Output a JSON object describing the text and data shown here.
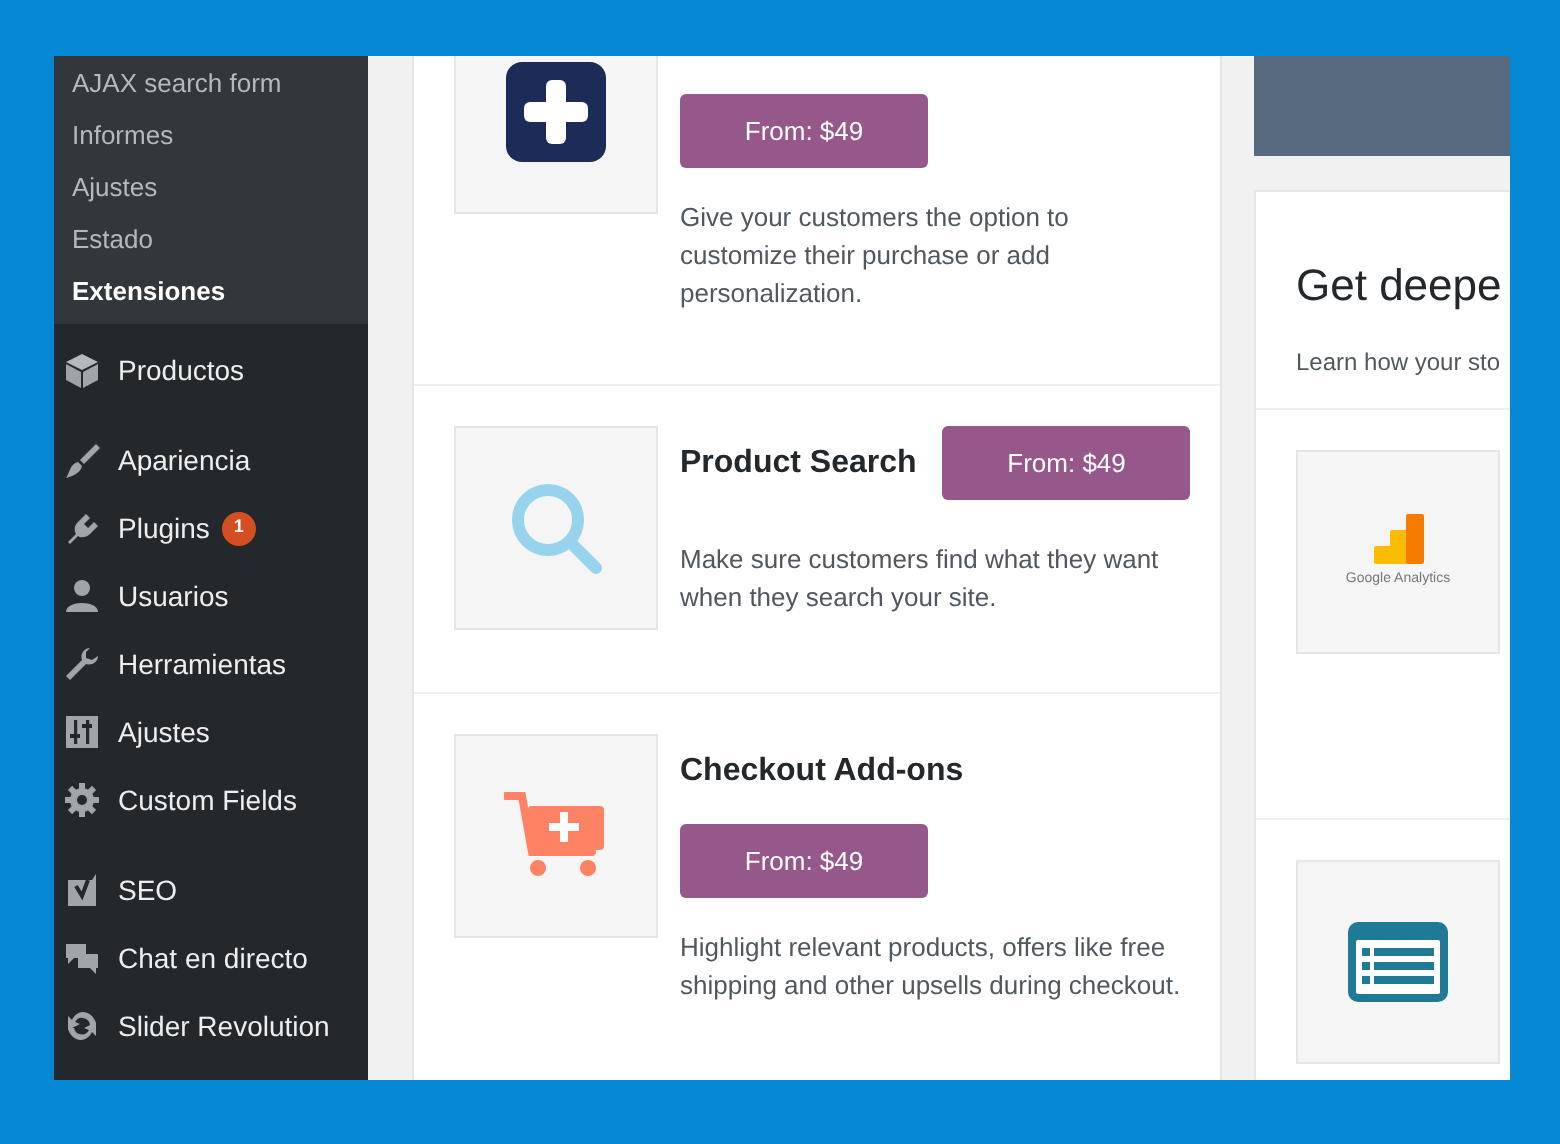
{
  "sidebar": {
    "submenu": [
      {
        "label": "AJAX search form",
        "selected": false
      },
      {
        "label": "Informes",
        "selected": false
      },
      {
        "label": "Ajustes",
        "selected": false
      },
      {
        "label": "Estado",
        "selected": false
      },
      {
        "label": "Extensiones",
        "selected": true
      }
    ],
    "menu": [
      {
        "label": "Productos"
      },
      {
        "label": "Apariencia"
      },
      {
        "label": "Plugins",
        "badge": "1"
      },
      {
        "label": "Usuarios"
      },
      {
        "label": "Herramientas"
      },
      {
        "label": "Ajustes"
      },
      {
        "label": "Custom Fields"
      },
      {
        "label": "SEO"
      },
      {
        "label": "Chat en directo"
      },
      {
        "label": "Slider Revolution"
      }
    ]
  },
  "extensions": [
    {
      "button": "From: $49",
      "description": "Give your customers the option to customize their purchase or add personalization."
    },
    {
      "title": "Product Search",
      "button": "From: $49",
      "description": "Make sure customers find what they want when they search your site."
    },
    {
      "title": "Checkout Add-ons",
      "button": "From: $49",
      "description": "Highlight relevant products, offers like free shipping and other upsells during checkout."
    }
  ],
  "insights": {
    "heading": "Get deepe",
    "text": "Learn how your sto",
    "items": [
      {
        "kind": "logo",
        "caption": "Google Analytics"
      },
      {
        "kind": "icon"
      }
    ]
  }
}
